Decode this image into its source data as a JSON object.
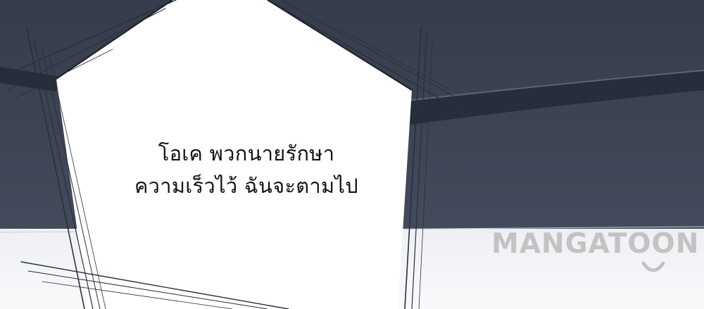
{
  "scene": {
    "colors": {
      "dark_background": "#3b4251",
      "dark_band": "#2c3240",
      "speech_bubble": "#ffffff",
      "light_floor": "#f4f5f7",
      "ink": "#111111",
      "watermark_gray": "#c3c3c3"
    }
  },
  "speech_bubble": {
    "line1": "โอเค พวกนายรักษา",
    "line2": "ความเร็วไว้ ฉันจะตามไป"
  },
  "watermark": {
    "text": "MANGATOON",
    "icon": "smile-arc-icon"
  }
}
